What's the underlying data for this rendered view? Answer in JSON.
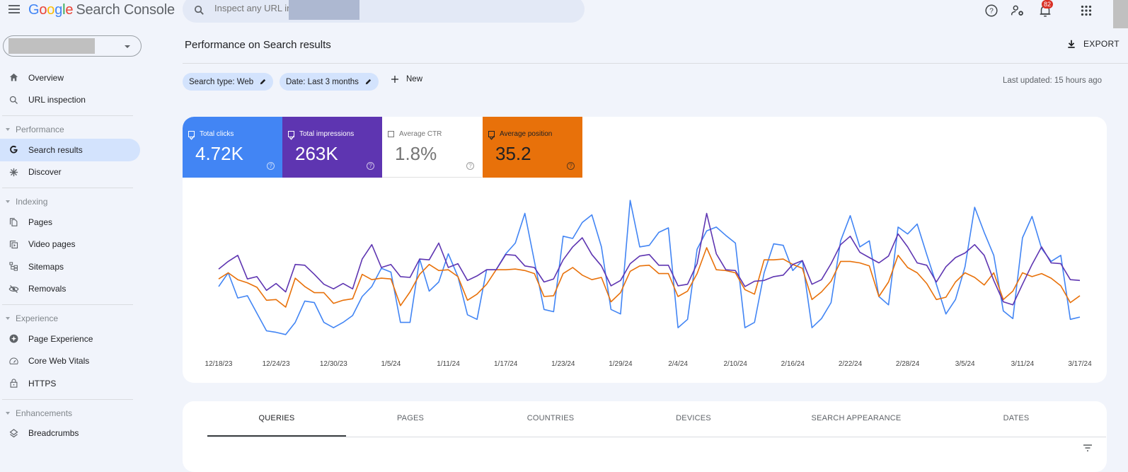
{
  "app": {
    "brand_letters": [
      "G",
      "o",
      "o",
      "g",
      "l",
      "e"
    ],
    "product": "Search Console"
  },
  "search": {
    "placeholder": "Inspect any URL in"
  },
  "header_icons": {
    "help": "help-icon",
    "admin": "manage-users-icon",
    "notifications": "notifications-icon",
    "notifications_count": "82",
    "apps": "apps-grid-icon"
  },
  "sidebar": {
    "items": [
      {
        "label": "Overview",
        "icon": "home-icon"
      },
      {
        "label": "URL inspection",
        "icon": "search-icon"
      }
    ],
    "sections": [
      {
        "title": "Performance",
        "items": [
          {
            "label": "Search results",
            "icon": "google-g-icon",
            "active": true
          },
          {
            "label": "Discover",
            "icon": "asterisk-icon"
          }
        ]
      },
      {
        "title": "Indexing",
        "items": [
          {
            "label": "Pages",
            "icon": "pages-icon"
          },
          {
            "label": "Video pages",
            "icon": "video-pages-icon"
          },
          {
            "label": "Sitemaps",
            "icon": "sitemap-icon"
          },
          {
            "label": "Removals",
            "icon": "visibility-off-icon"
          }
        ]
      },
      {
        "title": "Experience",
        "items": [
          {
            "label": "Page Experience",
            "icon": "page-experience-icon"
          },
          {
            "label": "Core Web Vitals",
            "icon": "speed-gauge-icon"
          },
          {
            "label": "HTTPS",
            "icon": "lock-icon"
          }
        ]
      },
      {
        "title": "Enhancements",
        "items": [
          {
            "label": "Breadcrumbs",
            "icon": "layers-icon"
          }
        ]
      }
    ]
  },
  "page": {
    "title": "Performance on Search results",
    "export_label": "EXPORT",
    "filters": [
      {
        "label": "Search type: Web"
      },
      {
        "label": "Date: Last 3 months"
      }
    ],
    "new_label": "New",
    "last_updated": "Last updated: 15 hours ago"
  },
  "metrics": [
    {
      "label": "Total clicks",
      "value": "4.72K",
      "checked": true,
      "color": "#4285f4"
    },
    {
      "label": "Total impressions",
      "value": "263K",
      "checked": true,
      "color": "#5e35b1"
    },
    {
      "label": "Average CTR",
      "value": "1.8%",
      "checked": false,
      "color": "#00897b"
    },
    {
      "label": "Average position",
      "value": "35.2",
      "checked": true,
      "color": "#e8710a"
    }
  ],
  "chart_data": {
    "type": "line",
    "title": "",
    "xlabel": "",
    "ylabel": "",
    "y_axis_note": "Y axes hidden in UI; values are relative indices (0-180) estimated from line height",
    "ylim": [
      0,
      180
    ],
    "start_date": "12/18/23",
    "end_date": "3/17/24",
    "x_tick_labels": [
      "12/18/23",
      "12/24/23",
      "12/30/23",
      "1/5/24",
      "1/11/24",
      "1/17/24",
      "1/23/24",
      "1/29/24",
      "2/4/24",
      "2/10/24",
      "2/16/24",
      "2/22/24",
      "2/28/24",
      "3/5/24",
      "3/11/24",
      "3/17/24"
    ],
    "x_tick_every_days": 6,
    "legend": "none",
    "grid": false,
    "series": [
      {
        "name": "Total clicks",
        "color": "#4285f4",
        "values": [
          65,
          83,
          50,
          53,
          30,
          7,
          5,
          2,
          18,
          46,
          44,
          18,
          11,
          18,
          27,
          52,
          65,
          89,
          84,
          18,
          18,
          101,
          59,
          71,
          108,
          78,
          28,
          22,
          87,
          87,
          108,
          122,
          161,
          98,
          35,
          32,
          131,
          128,
          149,
          159,
          117,
          35,
          29,
          178,
          117,
          119,
          136,
          142,
          11,
          22,
          114,
          138,
          143,
          132,
          122,
          11,
          18,
          83,
          121,
          119,
          86,
          99,
          11,
          23,
          44,
          125,
          158,
          117,
          125,
          52,
          41,
          143,
          134,
          147,
          107,
          68,
          29,
          48,
          91,
          169,
          136,
          106,
          33,
          23,
          129,
          157,
          115,
          98,
          106,
          22,
          25
        ]
      },
      {
        "name": "Total impressions",
        "color": "#5e35b1",
        "values": [
          88,
          98,
          106,
          75,
          78,
          60,
          69,
          58,
          94,
          93,
          81,
          68,
          62,
          69,
          62,
          101,
          120,
          90,
          94,
          78,
          77,
          101,
          100,
          122,
          90,
          95,
          73,
          79,
          87,
          87,
          107,
          106,
          92,
          90,
          71,
          75,
          100,
          117,
          129,
          107,
          92,
          66,
          73,
          95,
          105,
          107,
          93,
          93,
          66,
          68,
          95,
          161,
          108,
          87,
          86,
          65,
          72,
          73,
          78,
          80,
          94,
          99,
          68,
          74,
          95,
          120,
          131,
          110,
          103,
          96,
          105,
          134,
          117,
          96,
          93,
          71,
          91,
          103,
          109,
          120,
          106,
          73,
          45,
          41,
          68,
          94,
          117,
          96,
          95,
          74,
          73
        ]
      },
      {
        "name": "Average position",
        "color": "#e8710a",
        "values": [
          75,
          83,
          74,
          70,
          64,
          47,
          48,
          38,
          76,
          65,
          57,
          57,
          43,
          47,
          49,
          81,
          74,
          76,
          75,
          40,
          58,
          81,
          94,
          86,
          87,
          78,
          47,
          55,
          68,
          87,
          87,
          88,
          86,
          82,
          52,
          53,
          82,
          90,
          80,
          74,
          77,
          45,
          57,
          85,
          92,
          93,
          82,
          82,
          52,
          59,
          82,
          116,
          87,
          86,
          83,
          61,
          55,
          100,
          100,
          101,
          94,
          89,
          48,
          58,
          72,
          98,
          98,
          96,
          92,
          52,
          71,
          106,
          90,
          83,
          69,
          48,
          51,
          71,
          83,
          77,
          67,
          83,
          48,
          59,
          83,
          78,
          82,
          76,
          66,
          44,
          53
        ]
      }
    ]
  },
  "tabs": [
    {
      "label": "QUERIES",
      "active": true
    },
    {
      "label": "PAGES"
    },
    {
      "label": "COUNTRIES"
    },
    {
      "label": "DEVICES"
    },
    {
      "label": "SEARCH APPEARANCE"
    },
    {
      "label": "DATES"
    }
  ]
}
